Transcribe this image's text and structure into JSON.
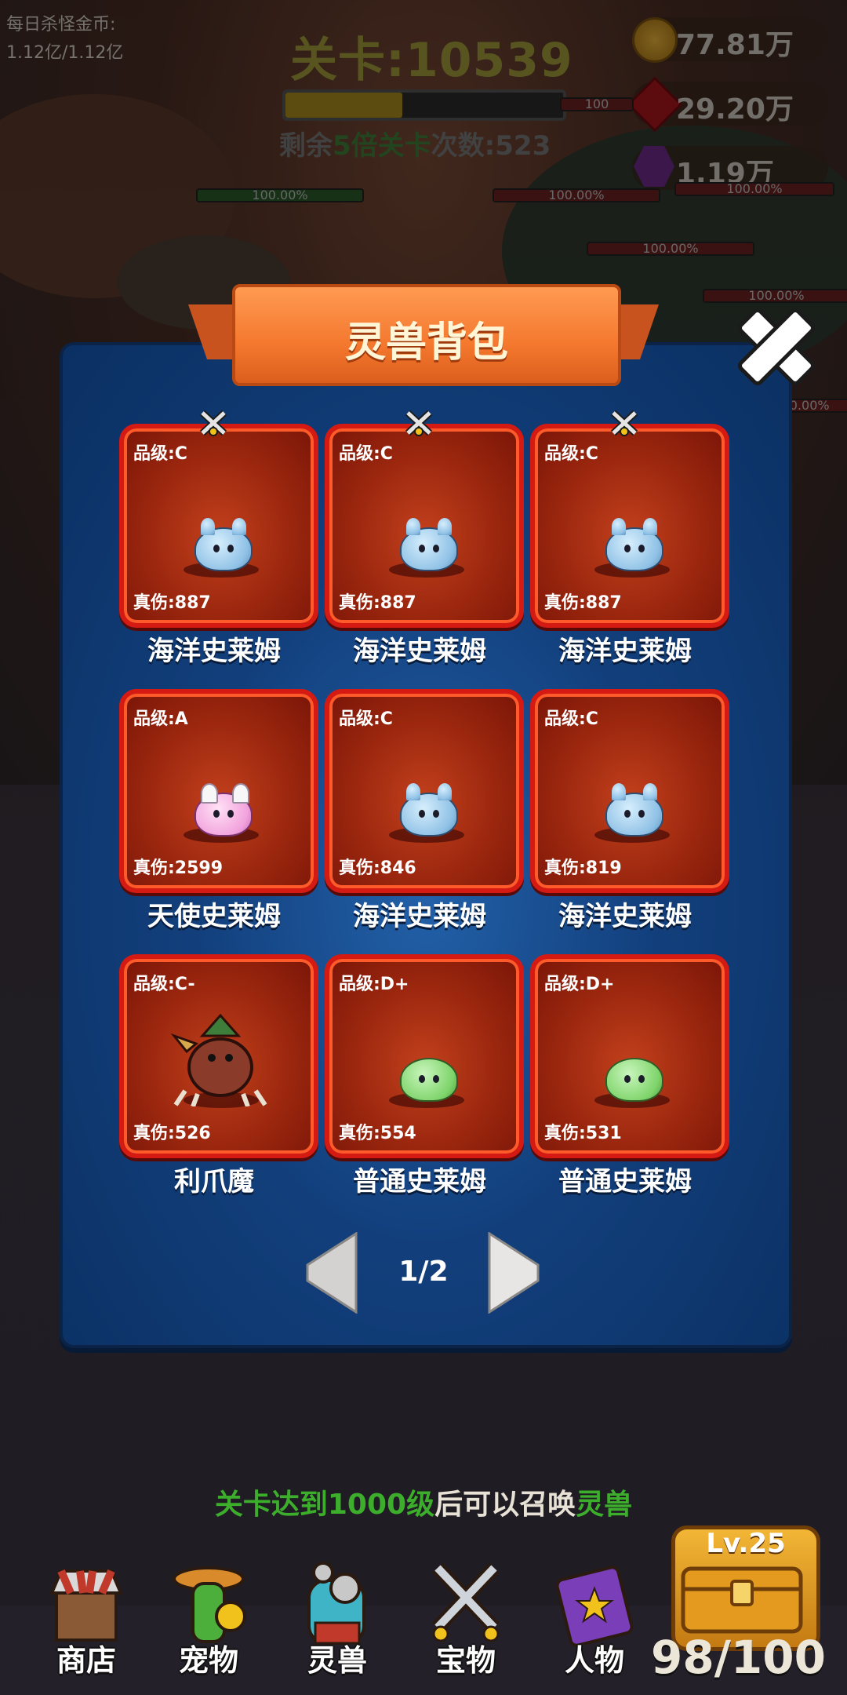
{
  "header": {
    "daily_label": "每日杀怪金币:",
    "daily_value": "1.12亿/1.12亿",
    "stage_title": "关卡:10539",
    "stage_progress_fraction": 0.42,
    "remain_prefix": "剩余",
    "remain_highlight": "5倍关卡",
    "remain_suffix": "次数:523"
  },
  "currency": {
    "gold": "77.81万",
    "ruby": "29.20万",
    "amethyst": "1.19万"
  },
  "scene_hp_labels": [
    "100.00%",
    "100.00%",
    "100.00%",
    "100.00%",
    "100.00%",
    "100.00%",
    "100"
  ],
  "modal": {
    "title": "灵兽背包",
    "page_indicator": "1/2"
  },
  "pets": [
    {
      "grade": "品级:C",
      "damage": "真伤:887",
      "name": "海洋史莱姆",
      "type": "ocean",
      "equipped": true
    },
    {
      "grade": "品级:C",
      "damage": "真伤:887",
      "name": "海洋史莱姆",
      "type": "ocean",
      "equipped": true
    },
    {
      "grade": "品级:C",
      "damage": "真伤:887",
      "name": "海洋史莱姆",
      "type": "ocean",
      "equipped": true
    },
    {
      "grade": "品级:A",
      "damage": "真伤:2599",
      "name": "天使史莱姆",
      "type": "angel",
      "equipped": false
    },
    {
      "grade": "品级:C",
      "damage": "真伤:846",
      "name": "海洋史莱姆",
      "type": "ocean",
      "equipped": false
    },
    {
      "grade": "品级:C",
      "damage": "真伤:819",
      "name": "海洋史莱姆",
      "type": "ocean",
      "equipped": false
    },
    {
      "grade": "品级:C-",
      "damage": "真伤:526",
      "name": "利爪魔",
      "type": "claw",
      "equipped": false
    },
    {
      "grade": "品级:D+",
      "damage": "真伤:554",
      "name": "普通史莱姆",
      "type": "common",
      "equipped": false
    },
    {
      "grade": "品级:D+",
      "damage": "真伤:531",
      "name": "普通史莱姆",
      "type": "common",
      "equipped": false
    }
  ],
  "hint": {
    "part1": "关卡达到1000级",
    "part2": "后可以召唤",
    "part3": "灵兽"
  },
  "nav": [
    {
      "label": "商店",
      "icon": "shop-stall-icon"
    },
    {
      "label": "宠物",
      "icon": "cactus-pet-icon"
    },
    {
      "label": "灵兽",
      "icon": "spirit-beast-icon"
    },
    {
      "label": "宝物",
      "icon": "crossed-swords-icon"
    },
    {
      "label": "人物",
      "icon": "spellbook-icon"
    }
  ],
  "chest": {
    "level": "Lv.25",
    "count": "98/100"
  }
}
